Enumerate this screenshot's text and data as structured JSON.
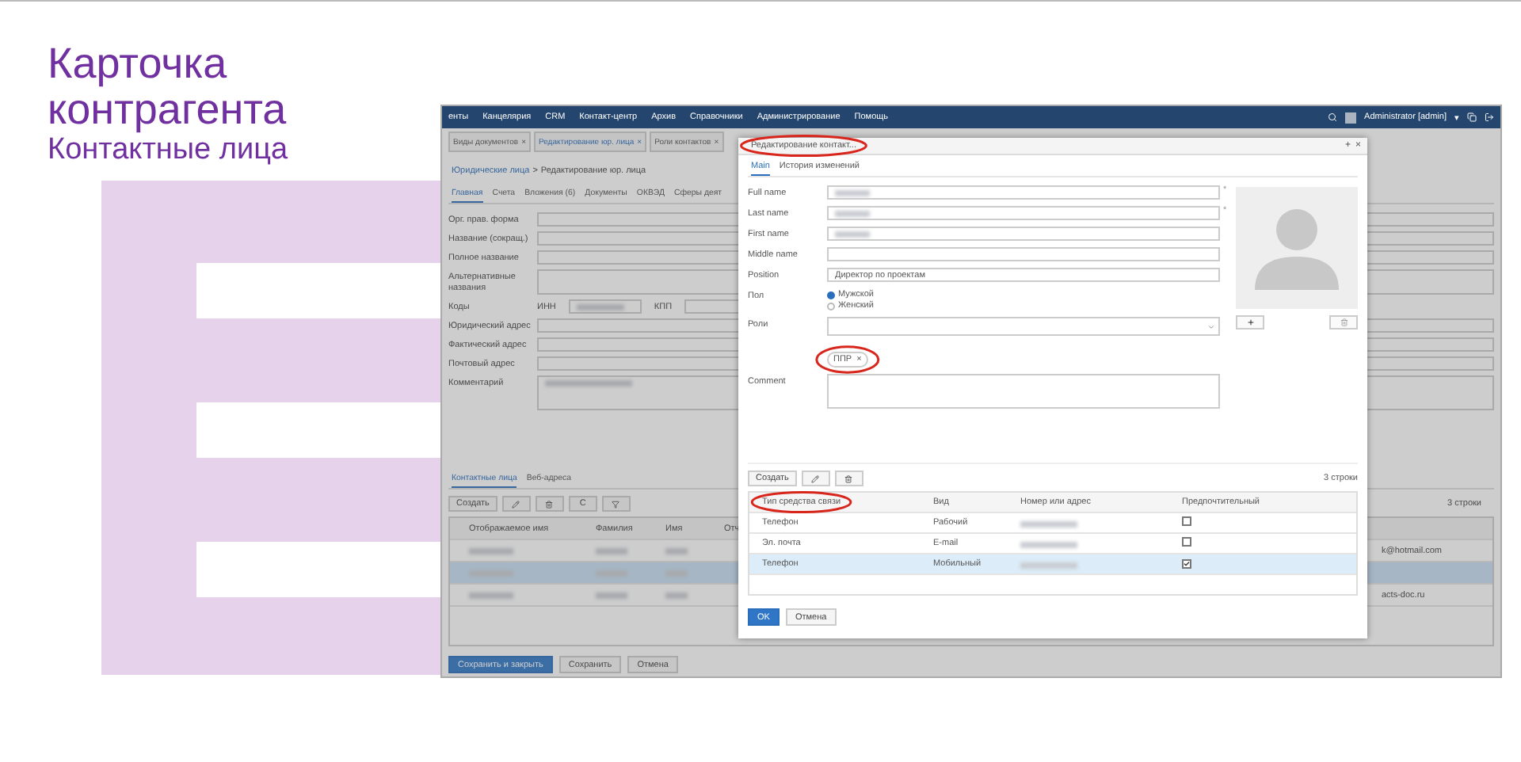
{
  "slide": {
    "title_lines": [
      "Карточка",
      "контрагента"
    ],
    "subtitle": "Контактные лица"
  },
  "app": {
    "menu": [
      "енты",
      "Канцелярия",
      "CRM",
      "Контакт-центр",
      "Архив",
      "Справочники",
      "Администрирование",
      "Помощь"
    ],
    "user": "Administrator [admin]",
    "user_caret": "▾",
    "tabs": [
      {
        "label": "Виды документов",
        "close": "×",
        "selected": false
      },
      {
        "label": "Редактирование юр. лица",
        "close": "×",
        "selected": true
      },
      {
        "label": "Роли контактов",
        "close": "×",
        "selected": false
      }
    ],
    "breadcrumb": {
      "link": "Юридические лица",
      "separator": ">",
      "current": "Редактирование юр. лица"
    },
    "subtabs": [
      {
        "label": "Главная",
        "selected": true
      },
      {
        "label": "Счета",
        "selected": false
      },
      {
        "label": "Вложения (6)",
        "selected": false
      },
      {
        "label": "Документы",
        "selected": false
      },
      {
        "label": "ОКВЭД",
        "selected": false
      },
      {
        "label": "Сферы деят",
        "selected": false
      }
    ],
    "fields": [
      {
        "label": "Орг. прав. форма",
        "kind": "input"
      },
      {
        "label": "Название (сокращ.)",
        "kind": "input"
      },
      {
        "label": "Полное название",
        "kind": "input"
      },
      {
        "label": "Альтернативные названия",
        "kind": "tall"
      },
      {
        "label": "Коды",
        "kind": "codes",
        "parts": [
          "ИНН",
          "КПП"
        ],
        "redacted": true
      },
      {
        "label": "Юридический адрес",
        "kind": "input"
      },
      {
        "label": "Фактический адрес",
        "kind": "input"
      },
      {
        "label": "Почтовый адрес",
        "kind": "input"
      },
      {
        "label": "Комментарий",
        "kind": "textarea",
        "redacted": true
      }
    ],
    "bottom_tabs": [
      {
        "label": "Контактные лица",
        "selected": true
      },
      {
        "label": "Веб-адреса",
        "selected": false
      }
    ],
    "toolbar": {
      "create": "Создать",
      "refresh": "C"
    },
    "row_count": "3 строки",
    "columns": [
      "Отображаемое имя",
      "Фамилия",
      "Имя",
      "Отч"
    ],
    "rows": [
      {
        "selected": false,
        "email": "k@hotmail.com"
      },
      {
        "selected": true
      },
      {
        "selected": false,
        "email": "acts-doc.ru"
      }
    ],
    "buttons": [
      {
        "label": "Сохранить и закрыть",
        "primary": true
      },
      {
        "label": "Сохранить",
        "primary": false
      },
      {
        "label": "Отмена",
        "primary": false
      }
    ]
  },
  "dialog": {
    "title": "Редактирование контакт...",
    "title_highlighted": true,
    "window_buttons": [
      "+",
      "×"
    ],
    "tabs": [
      {
        "label": "Main",
        "selected": true
      },
      {
        "label": "История изменений",
        "selected": false
      }
    ],
    "fields": [
      {
        "label": "Full name",
        "kind": "input",
        "redacted": true,
        "marker": "*"
      },
      {
        "label": "Last name",
        "kind": "input",
        "redacted": true,
        "marker": "*"
      },
      {
        "label": "First name",
        "kind": "input",
        "redacted": true
      },
      {
        "label": "Middle name",
        "kind": "input"
      },
      {
        "label": "Position",
        "kind": "input",
        "value": "Директор по проектам"
      },
      {
        "label": "Пол",
        "kind": "radio",
        "options": [
          {
            "label": "Мужской",
            "selected": true
          },
          {
            "label": "Женский",
            "selected": false
          }
        ]
      },
      {
        "label": "Роли",
        "kind": "select",
        "chips": [
          {
            "label": "ППР",
            "remove": "×",
            "highlighted": true
          }
        ]
      },
      {
        "label": "Comment",
        "kind": "textarea"
      }
    ],
    "toolbar": {
      "create": "Создать"
    },
    "row_count": "3 строки",
    "columns": [
      {
        "label": "Тип средства связи",
        "highlighted": true
      },
      {
        "label": "Вид",
        "highlighted": false
      },
      {
        "label": "Номер или адрес",
        "highlighted": false
      },
      {
        "label": "Предпочтительный",
        "highlighted": false
      }
    ],
    "rows": [
      {
        "type": "Телефон",
        "kind_label": "Рабочий",
        "preferred": false,
        "selected": false
      },
      {
        "type": "Эл. почта",
        "kind_label": "E-mail",
        "preferred": false,
        "selected": false
      },
      {
        "type": "Телефон",
        "kind_label": "Мобильный",
        "preferred": true,
        "selected": true
      }
    ],
    "buttons": [
      {
        "label": "OK",
        "primary": true
      },
      {
        "label": "Отмена",
        "primary": false
      }
    ]
  }
}
